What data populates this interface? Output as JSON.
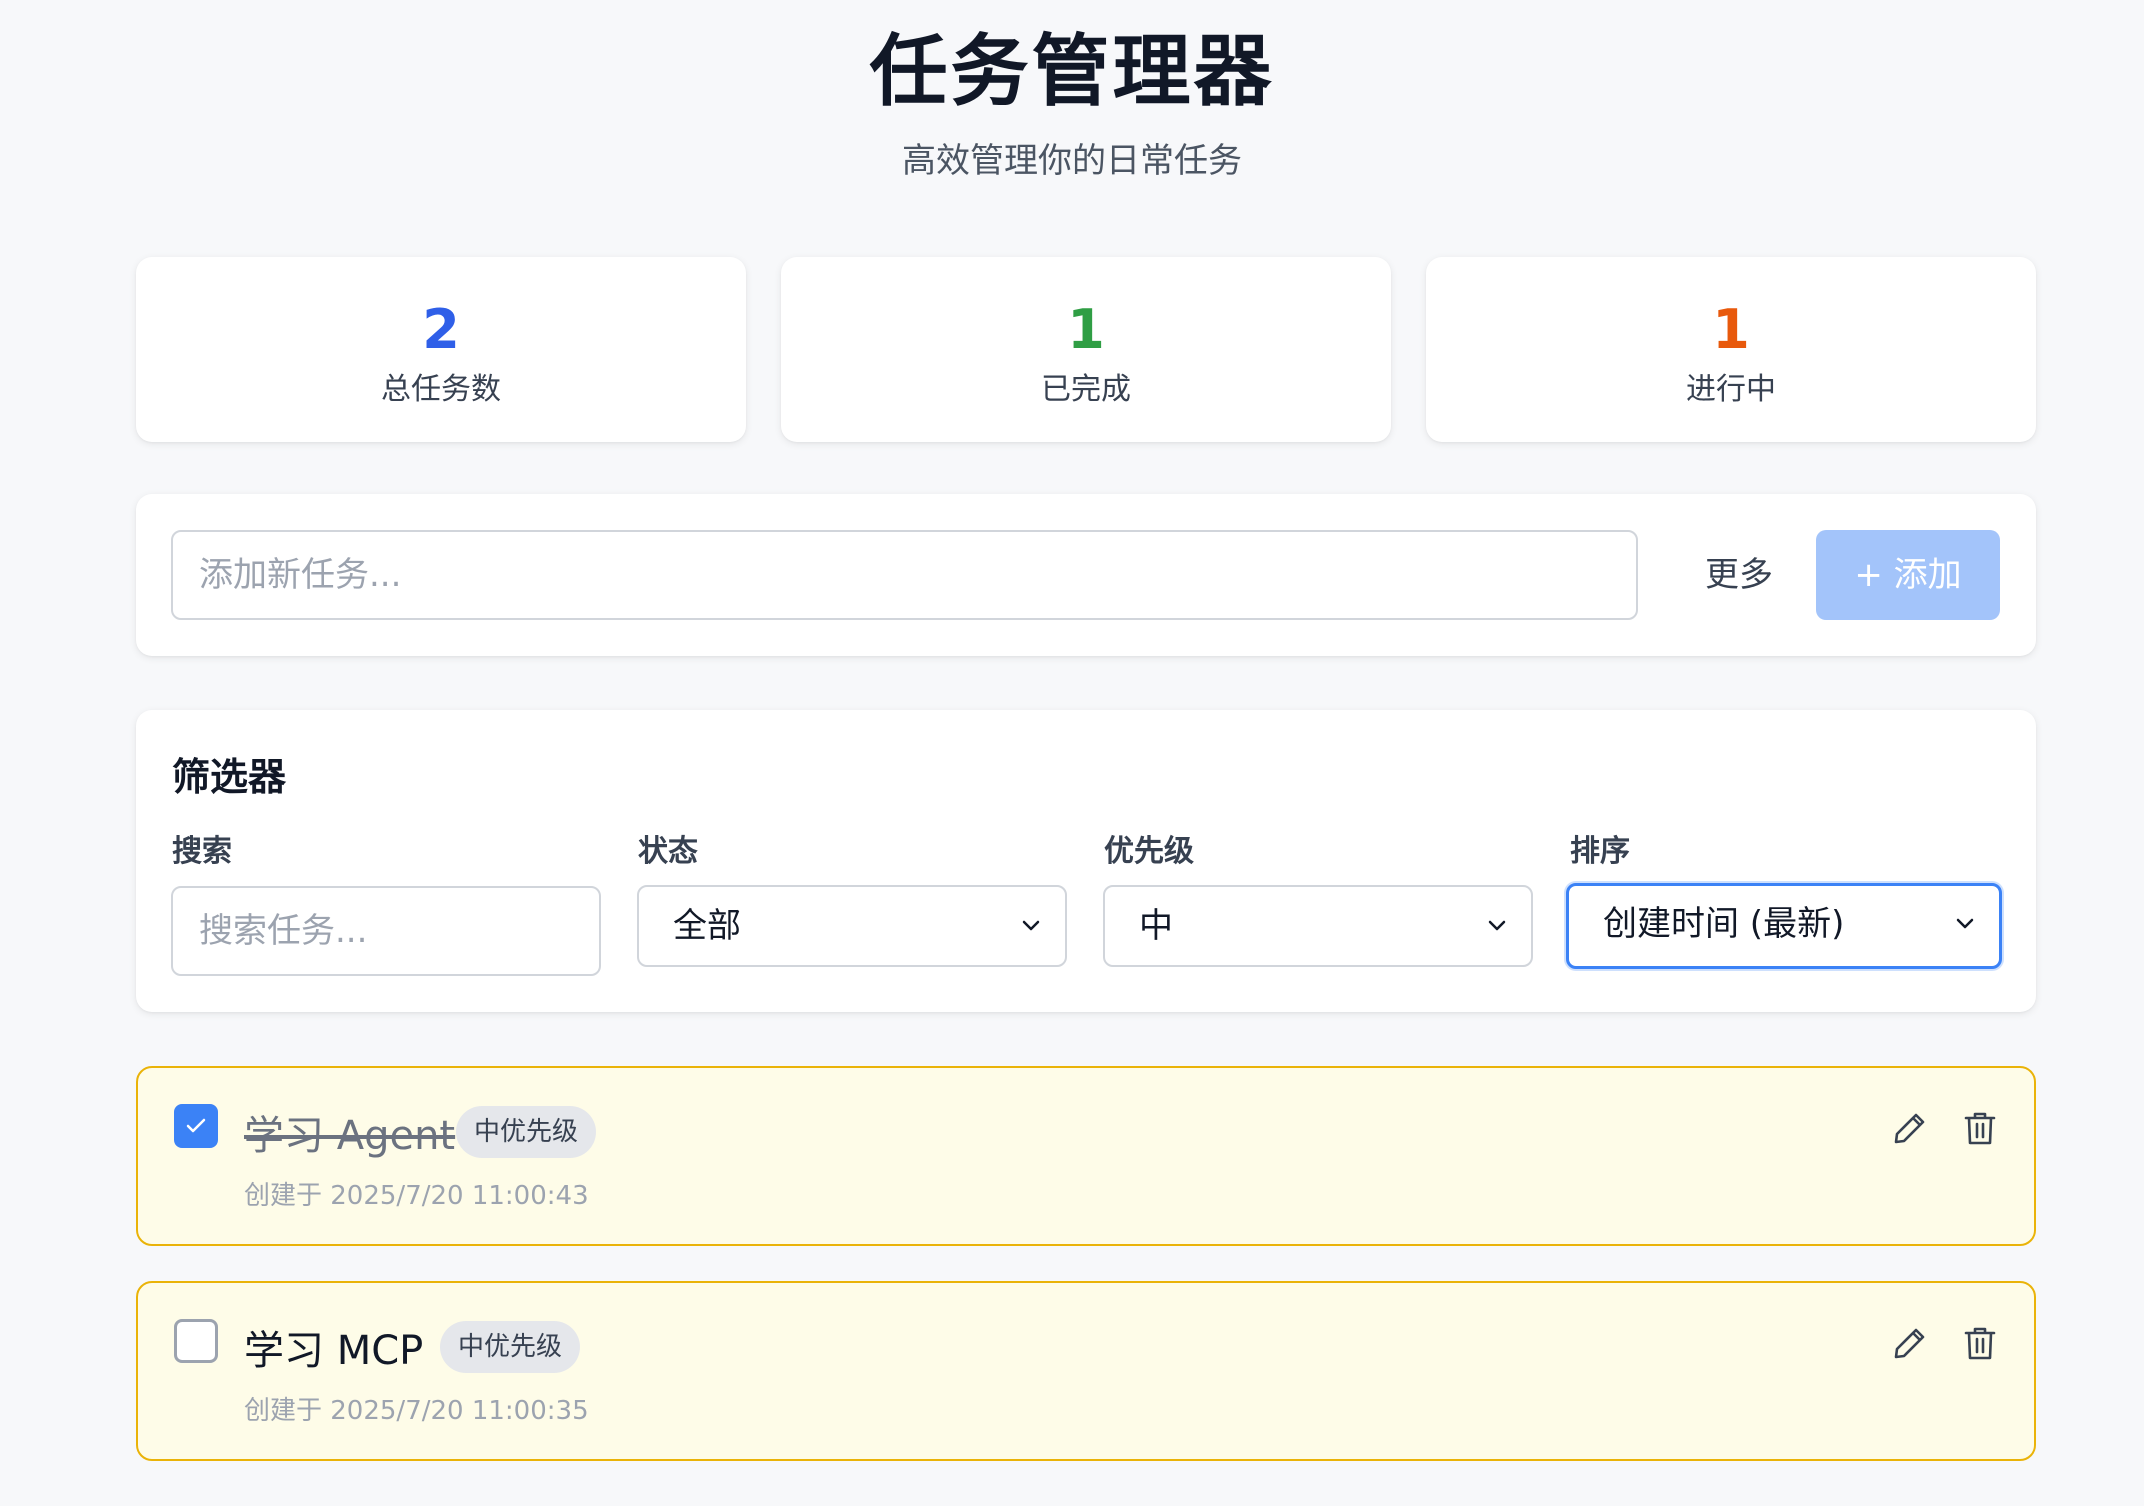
{
  "header": {
    "title": "任务管理器",
    "subtitle": "高效管理你的日常任务"
  },
  "stats": [
    {
      "value": "2",
      "label": "总任务数",
      "color": "#2f5fe8"
    },
    {
      "value": "1",
      "label": "已完成",
      "color": "#2f9e44"
    },
    {
      "value": "1",
      "label": "进行中",
      "color": "#e8590c"
    }
  ],
  "add_task": {
    "placeholder": "添加新任务...",
    "more_label": "更多",
    "add_label": "+ 添加"
  },
  "filters": {
    "title": "筛选器",
    "search": {
      "label": "搜索",
      "placeholder": "搜索任务..."
    },
    "status": {
      "label": "状态",
      "value": "全部"
    },
    "priority": {
      "label": "优先级",
      "value": "中"
    },
    "sort": {
      "label": "排序",
      "value": "创建时间 (最新)"
    }
  },
  "tasks": [
    {
      "title": "学习 Agent",
      "priority": "中优先级",
      "created": "创建于 2025/7/20 11:00:43",
      "completed": true
    },
    {
      "title": "学习 MCP",
      "priority": "中优先级",
      "created": "创建于 2025/7/20 11:00:35",
      "completed": false
    }
  ],
  "icons": {
    "edit": "pencil-icon",
    "delete": "trash-icon",
    "check": "check-icon",
    "dropdown": "chevron-down-icon"
  }
}
